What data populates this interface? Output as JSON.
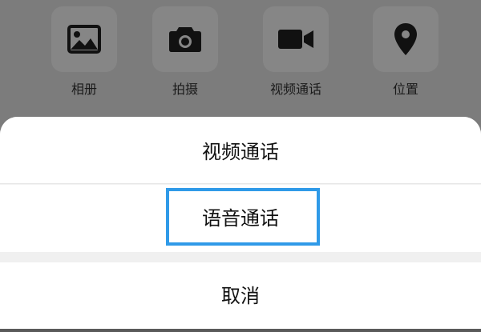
{
  "attachments": {
    "items": [
      {
        "label": "相册",
        "icon": "photo-album-icon"
      },
      {
        "label": "拍摄",
        "icon": "camera-icon"
      },
      {
        "label": "视频通话",
        "icon": "video-call-icon"
      },
      {
        "label": "位置",
        "icon": "location-pin-icon"
      }
    ]
  },
  "action_sheet": {
    "video_call_label": "视频通话",
    "voice_call_label": "语音通话",
    "cancel_label": "取消"
  },
  "colors": {
    "overlay_background": "#7c7c7c",
    "sheet_background": "#ffffff",
    "highlight_border": "#2f9ae8"
  }
}
